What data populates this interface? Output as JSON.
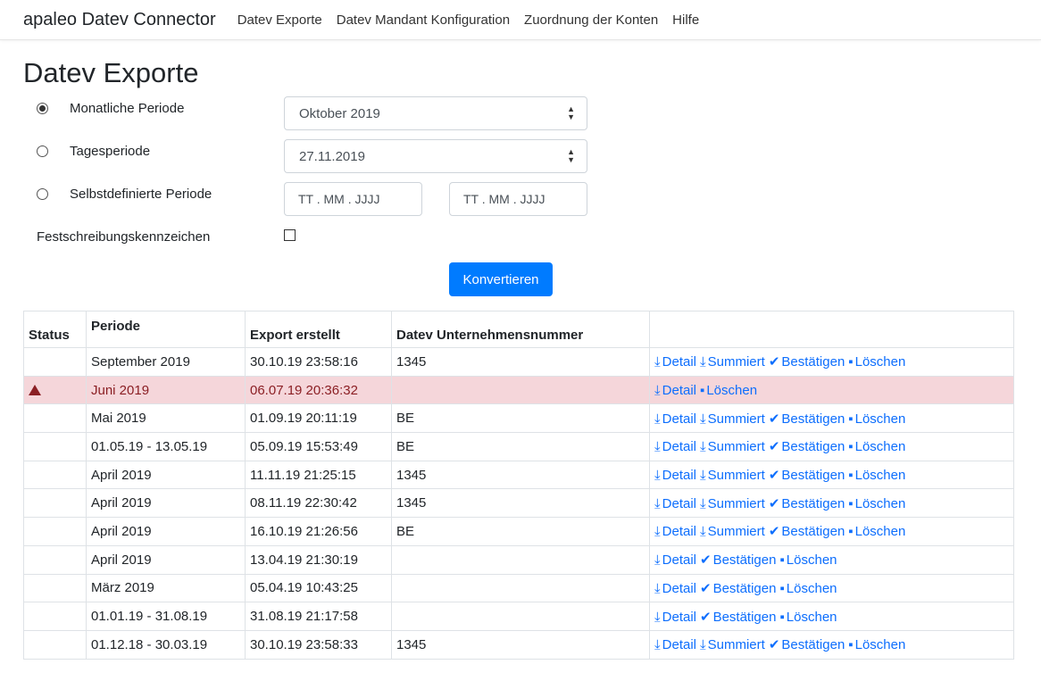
{
  "nav": {
    "brand": "apaleo Datev Connector",
    "links": [
      "Datev Exporte",
      "Datev Mandant Konfiguration",
      "Zuordnung der Konten",
      "Hilfe"
    ]
  },
  "page": {
    "title": "Datev Exporte"
  },
  "form": {
    "monthly_label": "Monatliche Periode",
    "monthly_value": "Oktober 2019",
    "daily_label": "Tagesperiode",
    "daily_value": "27.11.2019",
    "custom_label": "Selbstdefinierte Periode",
    "date_placeholder": "TT . MM . JJJJ",
    "lock_label": "Festschreibungskennzeichen",
    "convert_button": "Konvertieren"
  },
  "table": {
    "headers": [
      "Status",
      "Periode",
      "Export erstellt",
      "Datev Unternehmensnummer",
      ""
    ],
    "actions": {
      "detail": "Detail",
      "summary": "Summiert",
      "confirm": "Bestätigen",
      "delete": "Löschen"
    },
    "icons": {
      "download": "download-icon",
      "check": "check-icon",
      "delete": "file-icon",
      "warning": "warning-icon"
    },
    "rows": [
      {
        "period": "September 2019",
        "created": "30.10.19 23:58:16",
        "company": "1345",
        "status": ""
      },
      {
        "period": "Juni 2019",
        "created": "06.07.19 20:36:32",
        "company": "",
        "status": "warning"
      },
      {
        "period": "Mai 2019",
        "created": "01.09.19 20:11:19",
        "company": "BE",
        "status": ""
      },
      {
        "period": "01.05.19 - 13.05.19",
        "created": "05.09.19 15:53:49",
        "company": "BE",
        "status": ""
      },
      {
        "period": "April 2019",
        "created": "11.11.19 21:25:15",
        "company": "1345",
        "status": ""
      },
      {
        "period": "April 2019",
        "created": "08.11.19 22:30:42",
        "company": "1345",
        "status": ""
      },
      {
        "period": "April 2019",
        "created": "16.10.19 21:26:56",
        "company": "BE",
        "status": ""
      },
      {
        "period": "April 2019",
        "created": "13.04.19 21:30:19",
        "company": "",
        "status": ""
      },
      {
        "period": "März 2019",
        "created": "05.04.19 10:43:25",
        "company": "",
        "status": ""
      },
      {
        "period": "01.01.19 - 31.08.19",
        "created": "31.08.19 21:17:58",
        "company": "",
        "status": ""
      },
      {
        "period": "01.12.18 - 30.03.19",
        "created": "30.10.19 23:58:33",
        "company": "1345",
        "status": ""
      }
    ]
  },
  "colors": {
    "primary": "#007bff",
    "link": "#0d6efd",
    "danger_row": "#f5d6da",
    "danger_text": "#8b1f24"
  }
}
